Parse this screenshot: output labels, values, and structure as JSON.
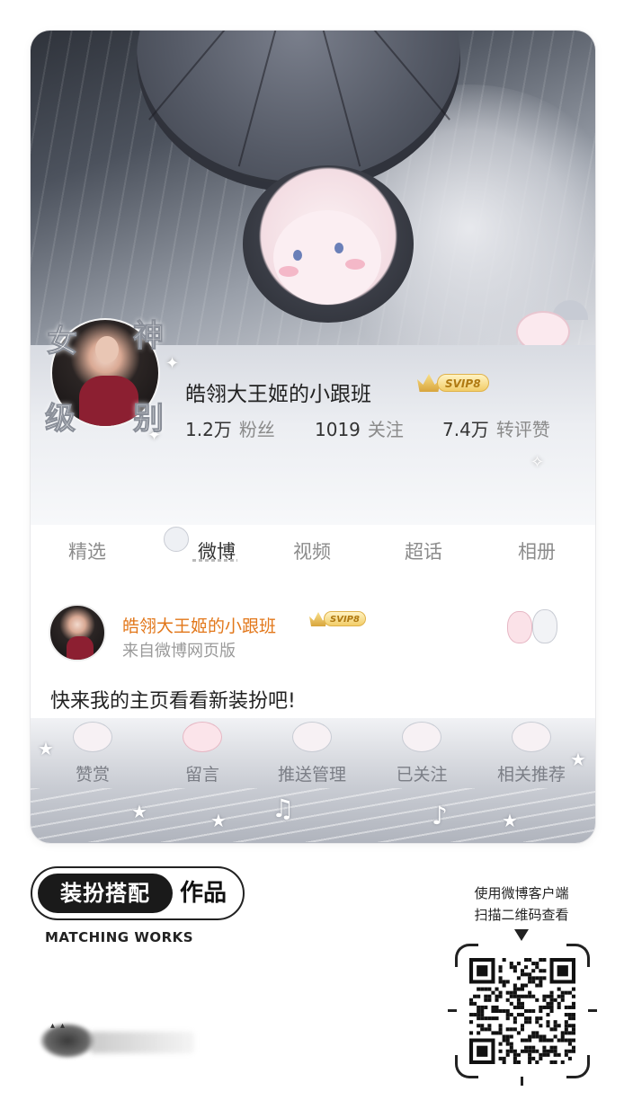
{
  "profile": {
    "name": "皓翎大王姬的小跟班",
    "vip_label": "SVIP8",
    "avatar_frame_text": [
      "女",
      "神",
      "级",
      "别"
    ],
    "stats": [
      {
        "value": "1.2万",
        "label": "粉丝"
      },
      {
        "value": "1019",
        "label": "关注"
      },
      {
        "value": "7.4万",
        "label": "转评赞"
      }
    ]
  },
  "tabs": [
    {
      "label": "精选",
      "active": false
    },
    {
      "label": "微博",
      "active": true
    },
    {
      "label": "视频",
      "active": false
    },
    {
      "label": "超话",
      "active": false
    },
    {
      "label": "相册",
      "active": false
    }
  ],
  "post": {
    "author": "皓翎大王姬的小跟班",
    "vip_label": "SVIP8",
    "source": "来自微博网页版",
    "text": "快来我的主页看看新装扮吧!"
  },
  "actions": [
    {
      "label": "赞赏",
      "icon": "cloud-mascot-icon"
    },
    {
      "label": "留言",
      "icon": "cat-mascot-icon"
    },
    {
      "label": "推送管理",
      "icon": "umbrella-mascot-icon"
    },
    {
      "label": "已关注",
      "icon": "frog-mascot-icon"
    },
    {
      "label": "相关推荐",
      "icon": "bird-mascot-icon"
    }
  ],
  "footer": {
    "badge_main": "装扮搭配",
    "badge_tail": "作品",
    "badge_sub": "MATCHING WORKS",
    "qr_caption_line1": "使用微博客户端",
    "qr_caption_line2": "扫描二维码查看"
  },
  "colors": {
    "author_name": "#e2771a",
    "vip_gold": "#f2cd68",
    "tab_active": "#333333",
    "tab_inactive": "#8c8c8c"
  }
}
